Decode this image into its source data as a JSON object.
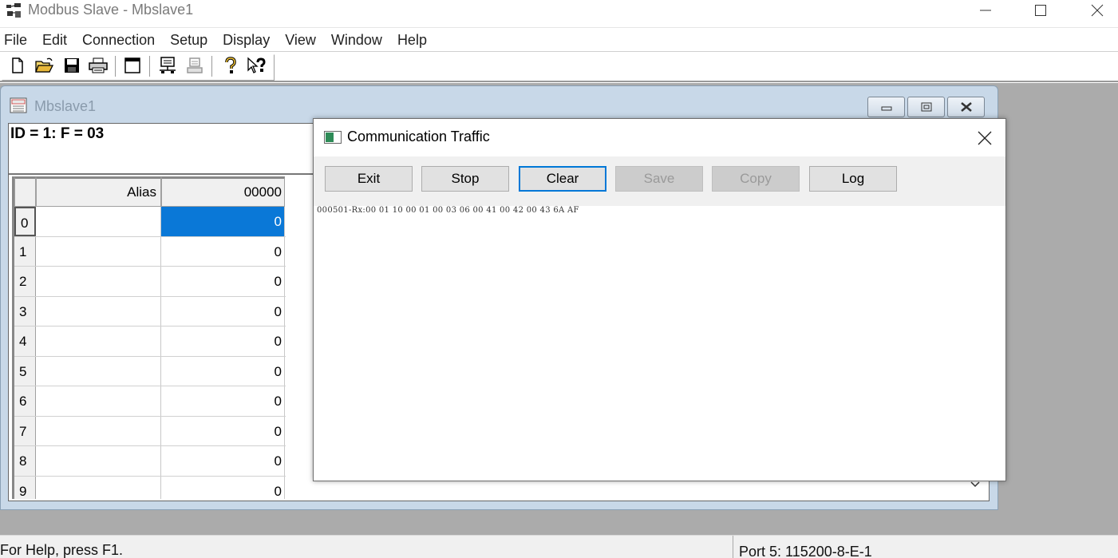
{
  "app": {
    "title": "Modbus Slave - Mbslave1"
  },
  "menu": [
    "File",
    "Edit",
    "Connection",
    "Setup",
    "Display",
    "View",
    "Window",
    "Help"
  ],
  "toolbar": {
    "icons": [
      "new-document-icon",
      "open-folder-icon",
      "save-disk-icon",
      "print-icon",
      "window-icon",
      "connect-icon",
      "disconnect-icon",
      "help-icon",
      "context-help-icon"
    ]
  },
  "child_window": {
    "title": "Mbslave1",
    "id_line": "ID = 1: F = 03",
    "grid": {
      "headers": {
        "alias": "Alias",
        "col": "00000"
      },
      "rows": [
        {
          "num": "0",
          "alias": "",
          "value": "0",
          "selected": true
        },
        {
          "num": "1",
          "alias": "",
          "value": "0"
        },
        {
          "num": "2",
          "alias": "",
          "value": "0"
        },
        {
          "num": "3",
          "alias": "",
          "value": "0"
        },
        {
          "num": "4",
          "alias": "",
          "value": "0"
        },
        {
          "num": "5",
          "alias": "",
          "value": "0"
        },
        {
          "num": "6",
          "alias": "",
          "value": "0"
        },
        {
          "num": "7",
          "alias": "",
          "value": "0"
        },
        {
          "num": "8",
          "alias": "",
          "value": "0"
        },
        {
          "num": "9",
          "alias": "",
          "value": "0"
        }
      ]
    }
  },
  "dialog": {
    "title": "Communication Traffic",
    "buttons": [
      {
        "label": "Exit",
        "enabled": true
      },
      {
        "label": "Stop",
        "enabled": true
      },
      {
        "label": "Clear",
        "enabled": true,
        "focused": true
      },
      {
        "label": "Save",
        "enabled": false
      },
      {
        "label": "Copy",
        "enabled": false
      },
      {
        "label": "Log",
        "enabled": true
      }
    ],
    "traffic_lines": [
      "000501-Rx:00 01 10 00 01 00 03 06 00 41 00 42 00 43 6A AF"
    ]
  },
  "status": {
    "help": "For Help, press F1.",
    "port": "Port 5: 115200-8-E-1"
  },
  "colors": {
    "selection": "#0a78d7",
    "mdi_background": "#ababab",
    "focus_border": "#0078d7"
  }
}
